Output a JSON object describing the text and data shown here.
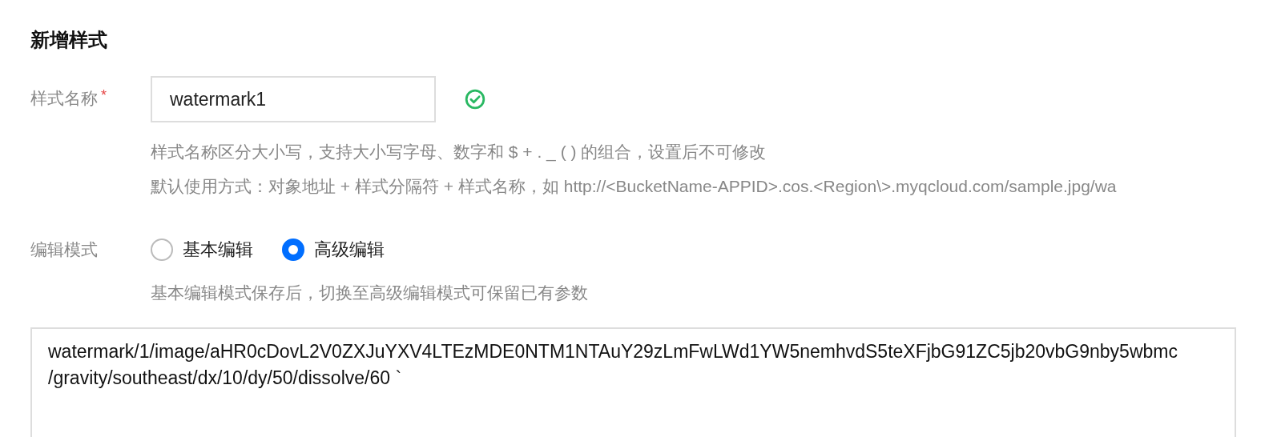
{
  "title": "新增样式",
  "name_field": {
    "label": "样式名称",
    "required": true,
    "required_mark": "*",
    "value": "watermark1",
    "valid": true,
    "hints": [
      "样式名称区分大小写，支持大小写字母、数字和 $ + . _ ( ) 的组合，设置后不可修改",
      "默认使用方式：对象地址 + 样式分隔符 + 样式名称，如 http://<BucketName-APPID>.cos.<Region\\>.myqcloud.com/sample.jpg/wa"
    ]
  },
  "edit_mode": {
    "label": "编辑模式",
    "options": [
      {
        "label": "基本编辑",
        "selected": false
      },
      {
        "label": "高级编辑",
        "selected": true
      }
    ],
    "hint": "基本编辑模式保存后，切换至高级编辑模式可保留已有参数"
  },
  "code_lines": [
    "watermark/1/image/aHR0cDovL2V0ZXJuYXV4LTEzMDE0NTM1NTAuY29zLmFwLWd1YW5nemhvdS5teXFjbG91ZC5jb20vbG9nby5wbmc",
    "/gravity/southeast/dx/10/dy/50/dissolve/60 `"
  ]
}
